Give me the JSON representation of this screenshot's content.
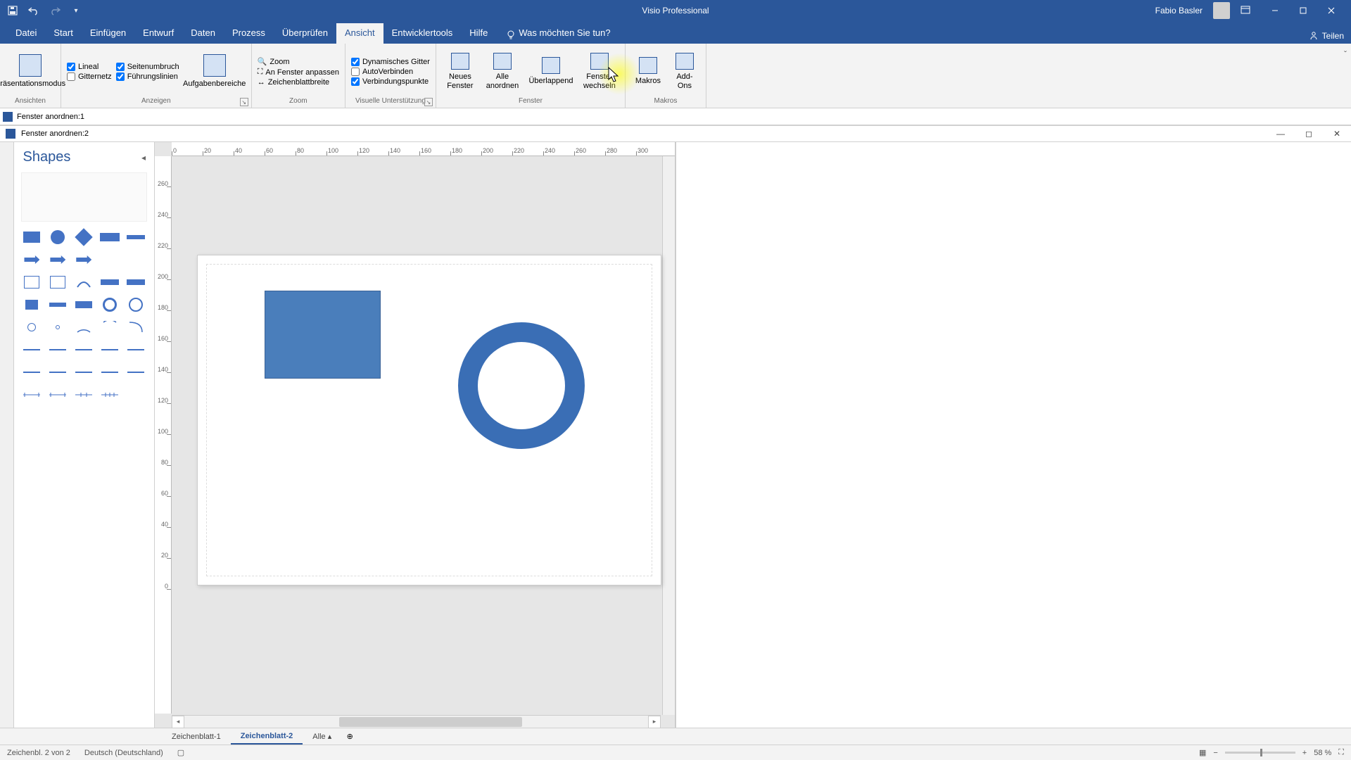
{
  "app": {
    "title": "Visio Professional"
  },
  "user": {
    "name": "Fabio Basler"
  },
  "share": {
    "label": "Teilen"
  },
  "search": {
    "placeholder": "Was möchten Sie tun?"
  },
  "tabs": {
    "datei": "Datei",
    "start": "Start",
    "einfuegen": "Einfügen",
    "entwurf": "Entwurf",
    "daten": "Daten",
    "prozess": "Prozess",
    "ueberpruefen": "Überprüfen",
    "ansicht": "Ansicht",
    "entwicklertools": "Entwicklertools",
    "hilfe": "Hilfe"
  },
  "ribbon": {
    "ansichten": {
      "label": "Ansichten",
      "praesentationsmodus": "Präsentationsmodus"
    },
    "anzeigen": {
      "label": "Anzeigen",
      "lineal": "Lineal",
      "gitternetz": "Gitternetz",
      "seitenumbruch": "Seitenumbruch",
      "fuehrungslinien": "Führungslinien",
      "aufgabenbereiche": "Aufgabenbereiche"
    },
    "zoom": {
      "label": "Zoom",
      "zoom": "Zoom",
      "fenster_anpassen": "An Fenster anpassen",
      "zeichenblattbreite": "Zeichenblattbreite"
    },
    "visuell": {
      "label": "Visuelle Unterstützung",
      "dyn_gitter": "Dynamisches Gitter",
      "autoverbinden": "AutoVerbinden",
      "verbindungspunkte": "Verbindungspunkte"
    },
    "fenster": {
      "label": "Fenster",
      "neues_fenster": "Neues\nFenster",
      "alle_anordnen": "Alle\nanordnen",
      "ueberlappend": "Überlappend",
      "fenster_wechseln": "Fenster\nwechseln"
    },
    "makros": {
      "label": "Makros",
      "makros": "Makros",
      "addons": "Add-Ons"
    }
  },
  "subwindows": {
    "w1": "Fenster anordnen:1",
    "w2": "Fenster anordnen:2"
  },
  "shapes": {
    "title": "Shapes"
  },
  "ruler_h": [
    "0",
    "20",
    "40",
    "60",
    "80",
    "100",
    "120",
    "140",
    "160",
    "180",
    "200",
    "220",
    "240",
    "260",
    "280",
    "300"
  ],
  "ruler_v": [
    "260",
    "240",
    "220",
    "200",
    "180",
    "160",
    "140",
    "120",
    "100",
    "80",
    "60",
    "40",
    "20",
    "0"
  ],
  "sheets": {
    "s1": "Zeichenblatt-1",
    "s2": "Zeichenblatt-2",
    "alle": "Alle"
  },
  "status": {
    "page_info": "Zeichenbl. 2 von 2",
    "lang": "Deutsch (Deutschland)",
    "zoom": "58 %"
  }
}
